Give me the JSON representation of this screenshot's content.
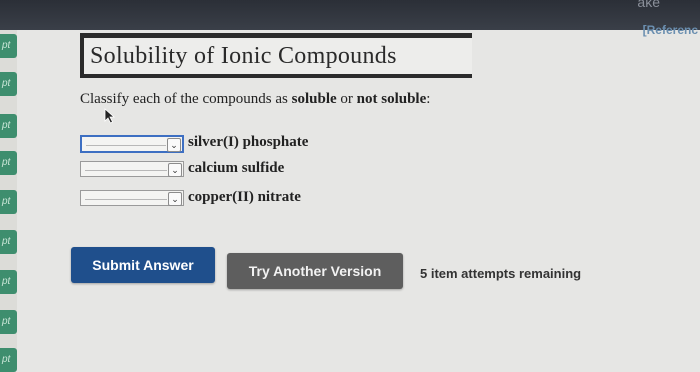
{
  "header": {
    "top_cut_text": "ake",
    "reference_label": "[Referenc"
  },
  "sidebar": {
    "items": [
      {
        "label": "pt"
      },
      {
        "label": "pt"
      },
      {
        "label": "pt"
      },
      {
        "label": "pt"
      },
      {
        "label": "pt"
      },
      {
        "label": "pt"
      },
      {
        "label": "pt"
      },
      {
        "label": "pt"
      },
      {
        "label": "pt"
      }
    ]
  },
  "question": {
    "title": "Solubility of Ionic Compounds",
    "instruction_prefix": "Classify each of the compounds as ",
    "option_soluble": "soluble",
    "instruction_or": " or ",
    "option_not_soluble": "not soluble",
    "instruction_suffix": ":",
    "compounds": [
      {
        "label": "silver(I) phosphate",
        "selected": ""
      },
      {
        "label": "calcium sulfide",
        "selected": ""
      },
      {
        "label": "copper(II) nitrate",
        "selected": ""
      }
    ]
  },
  "actions": {
    "submit_label": "Submit Answer",
    "try_another_label": "Try Another Version",
    "attempts_text": "5 item attempts remaining"
  },
  "colors": {
    "sidebar_green": "#3e8e6e",
    "submit_blue": "#1f4f8c",
    "try_gray": "#5e5e5e",
    "focus_blue": "#3d6fc2"
  }
}
